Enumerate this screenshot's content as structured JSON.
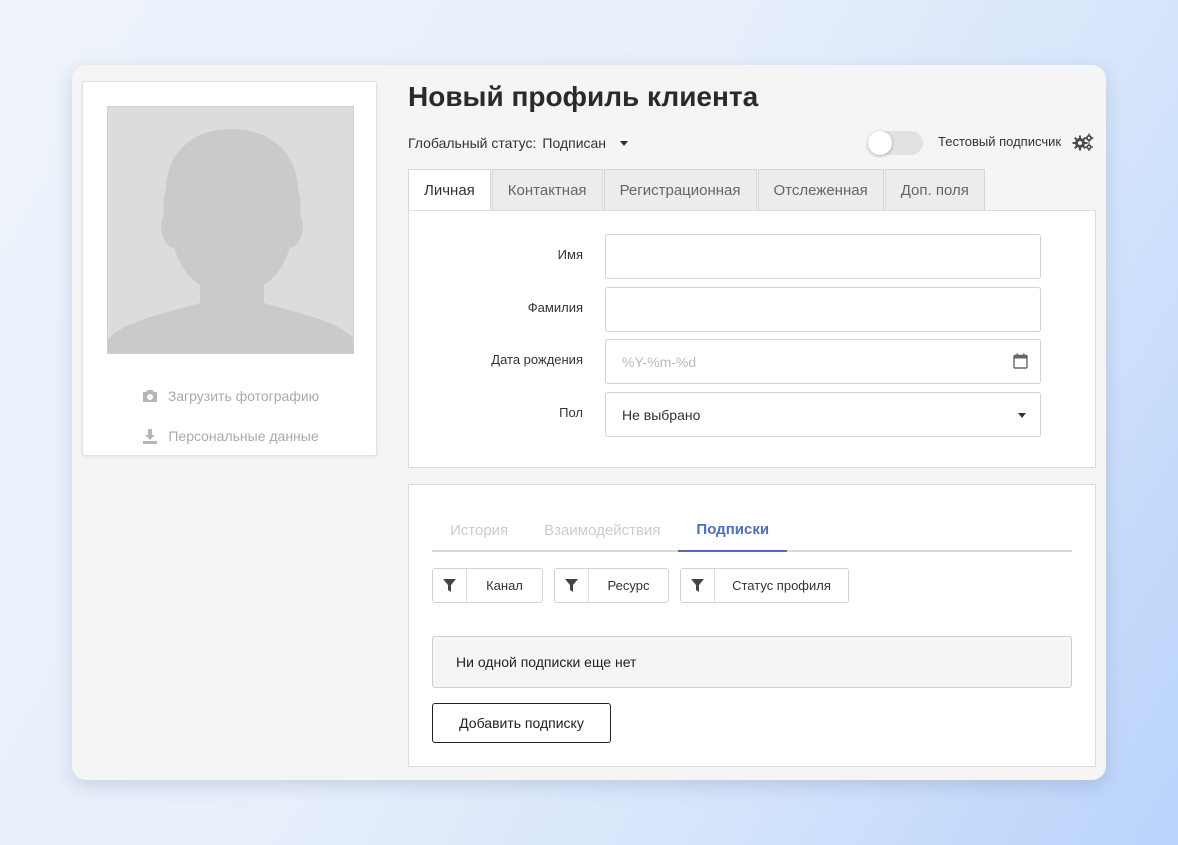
{
  "profile": {
    "title": "Новый профиль клиента",
    "global_status_label": "Глобальный статус:",
    "global_status_value": "Подписан",
    "test_subscriber_label": "Тестовый подписчик",
    "test_subscriber_enabled": false
  },
  "photo_card": {
    "upload_label": "Загрузить фотографию",
    "personal_data_label": "Персональные данные"
  },
  "tabs": [
    {
      "label": "Личная",
      "active": true
    },
    {
      "label": "Контактная",
      "active": false
    },
    {
      "label": "Регистрационная",
      "active": false
    },
    {
      "label": "Отслеженная",
      "active": false
    },
    {
      "label": "Доп. поля",
      "active": false
    }
  ],
  "form": {
    "first_name_label": "Имя",
    "first_name_value": "",
    "last_name_label": "Фамилия",
    "last_name_value": "",
    "birthdate_label": "Дата рождения",
    "birthdate_placeholder": "%Y-%m-%d",
    "gender_label": "Пол",
    "gender_value": "Не выбрано"
  },
  "activity": {
    "subtabs": [
      {
        "label": "История",
        "active": false
      },
      {
        "label": "Взаимодействия",
        "active": false
      },
      {
        "label": "Подписки",
        "active": true
      }
    ],
    "filters": [
      "Канал",
      "Ресурс",
      "Статус профиля"
    ],
    "empty_message": "Ни одной подписки еще нет",
    "add_button": "Добавить подписку"
  },
  "colors": {
    "accent": "#4f6fba",
    "panel_bg": "#f5f5f5"
  },
  "icons": {
    "upload": "camera-icon",
    "personal_data": "download-icon",
    "settings": "gears-icon",
    "date": "calendar-icon",
    "filter": "filter-icon"
  }
}
